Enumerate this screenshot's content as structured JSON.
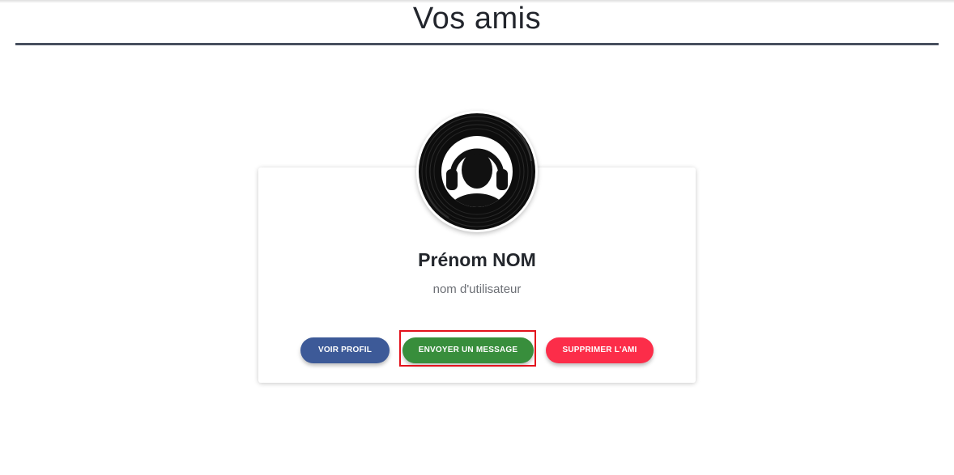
{
  "page": {
    "title": "Vos amis"
  },
  "friend_card": {
    "avatar_icon": "vinyl-headphones-user-icon",
    "name": "Prénom NOM",
    "username": "nom d'utilisateur",
    "buttons": {
      "view_profile": "VOIR PROFIL",
      "send_message": "ENVOYER UN MESSAGE",
      "remove_friend": "SUPPRIMER L'AMI"
    }
  },
  "colors": {
    "title_rule": "#474f5e",
    "view_profile_button": "#3d5a98",
    "send_message_button": "#388e3c",
    "remove_friend_button": "#fc2d49",
    "highlight_box": "#e3121c"
  }
}
